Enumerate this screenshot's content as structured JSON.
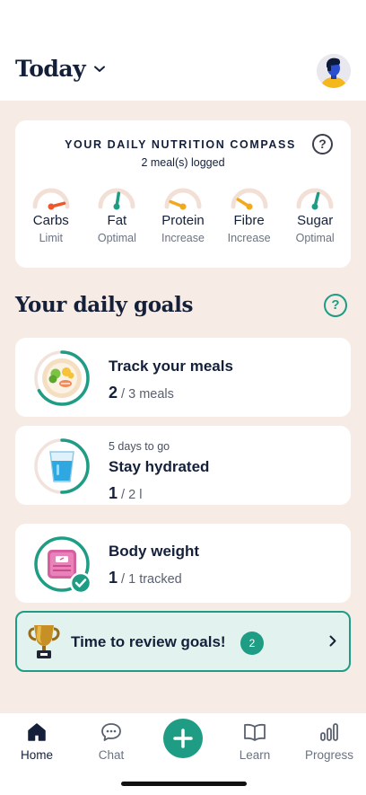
{
  "header": {
    "title": "Today"
  },
  "compass": {
    "title": "YOUR DAILY NUTRITION COMPASS",
    "help": "?",
    "subtitle": "2 meal(s) logged",
    "gauges": [
      {
        "name": "Carbs",
        "status": "Limit",
        "level": 0.92,
        "color": "#ec5a2a"
      },
      {
        "name": "Fat",
        "status": "Optimal",
        "level": 0.55,
        "color": "#1e9c84"
      },
      {
        "name": "Protein",
        "status": "Increase",
        "level": 0.12,
        "color": "#f2a91d"
      },
      {
        "name": "Fibre",
        "status": "Increase",
        "level": 0.18,
        "color": "#f2a91d"
      },
      {
        "name": "Sugar",
        "status": "Optimal",
        "level": 0.58,
        "color": "#1e9c84"
      }
    ]
  },
  "goals": {
    "title": "Your daily goals",
    "help": "?",
    "items": [
      {
        "kicker": "",
        "name": "Track your meals",
        "current": "2",
        "target": "/ 3 meals",
        "progress": 0.67,
        "complete": false
      },
      {
        "kicker": "5 days to go",
        "name": "Stay hydrated",
        "current": "1",
        "target": "/ 2 l",
        "progress": 0.5,
        "complete": false
      },
      {
        "kicker": "",
        "name": "Body weight",
        "current": "1",
        "target": "/ 1 tracked",
        "progress": 1.0,
        "complete": true
      }
    ]
  },
  "review": {
    "label": "Time to review goals!",
    "count": "2"
  },
  "tabs": [
    {
      "label": "Home",
      "icon": "home-icon",
      "active": true
    },
    {
      "label": "Chat",
      "icon": "chat-icon",
      "active": false
    },
    {
      "label": "",
      "icon": "add-icon",
      "active": false
    },
    {
      "label": "Learn",
      "icon": "book-icon",
      "active": false
    },
    {
      "label": "Progress",
      "icon": "bar-chart-icon",
      "active": false
    }
  ],
  "colors": {
    "accent": "#1e9c84",
    "background": "#f6ebe5",
    "text": "#14203a",
    "limit": "#ec5a2a",
    "increase": "#f2a91d"
  }
}
